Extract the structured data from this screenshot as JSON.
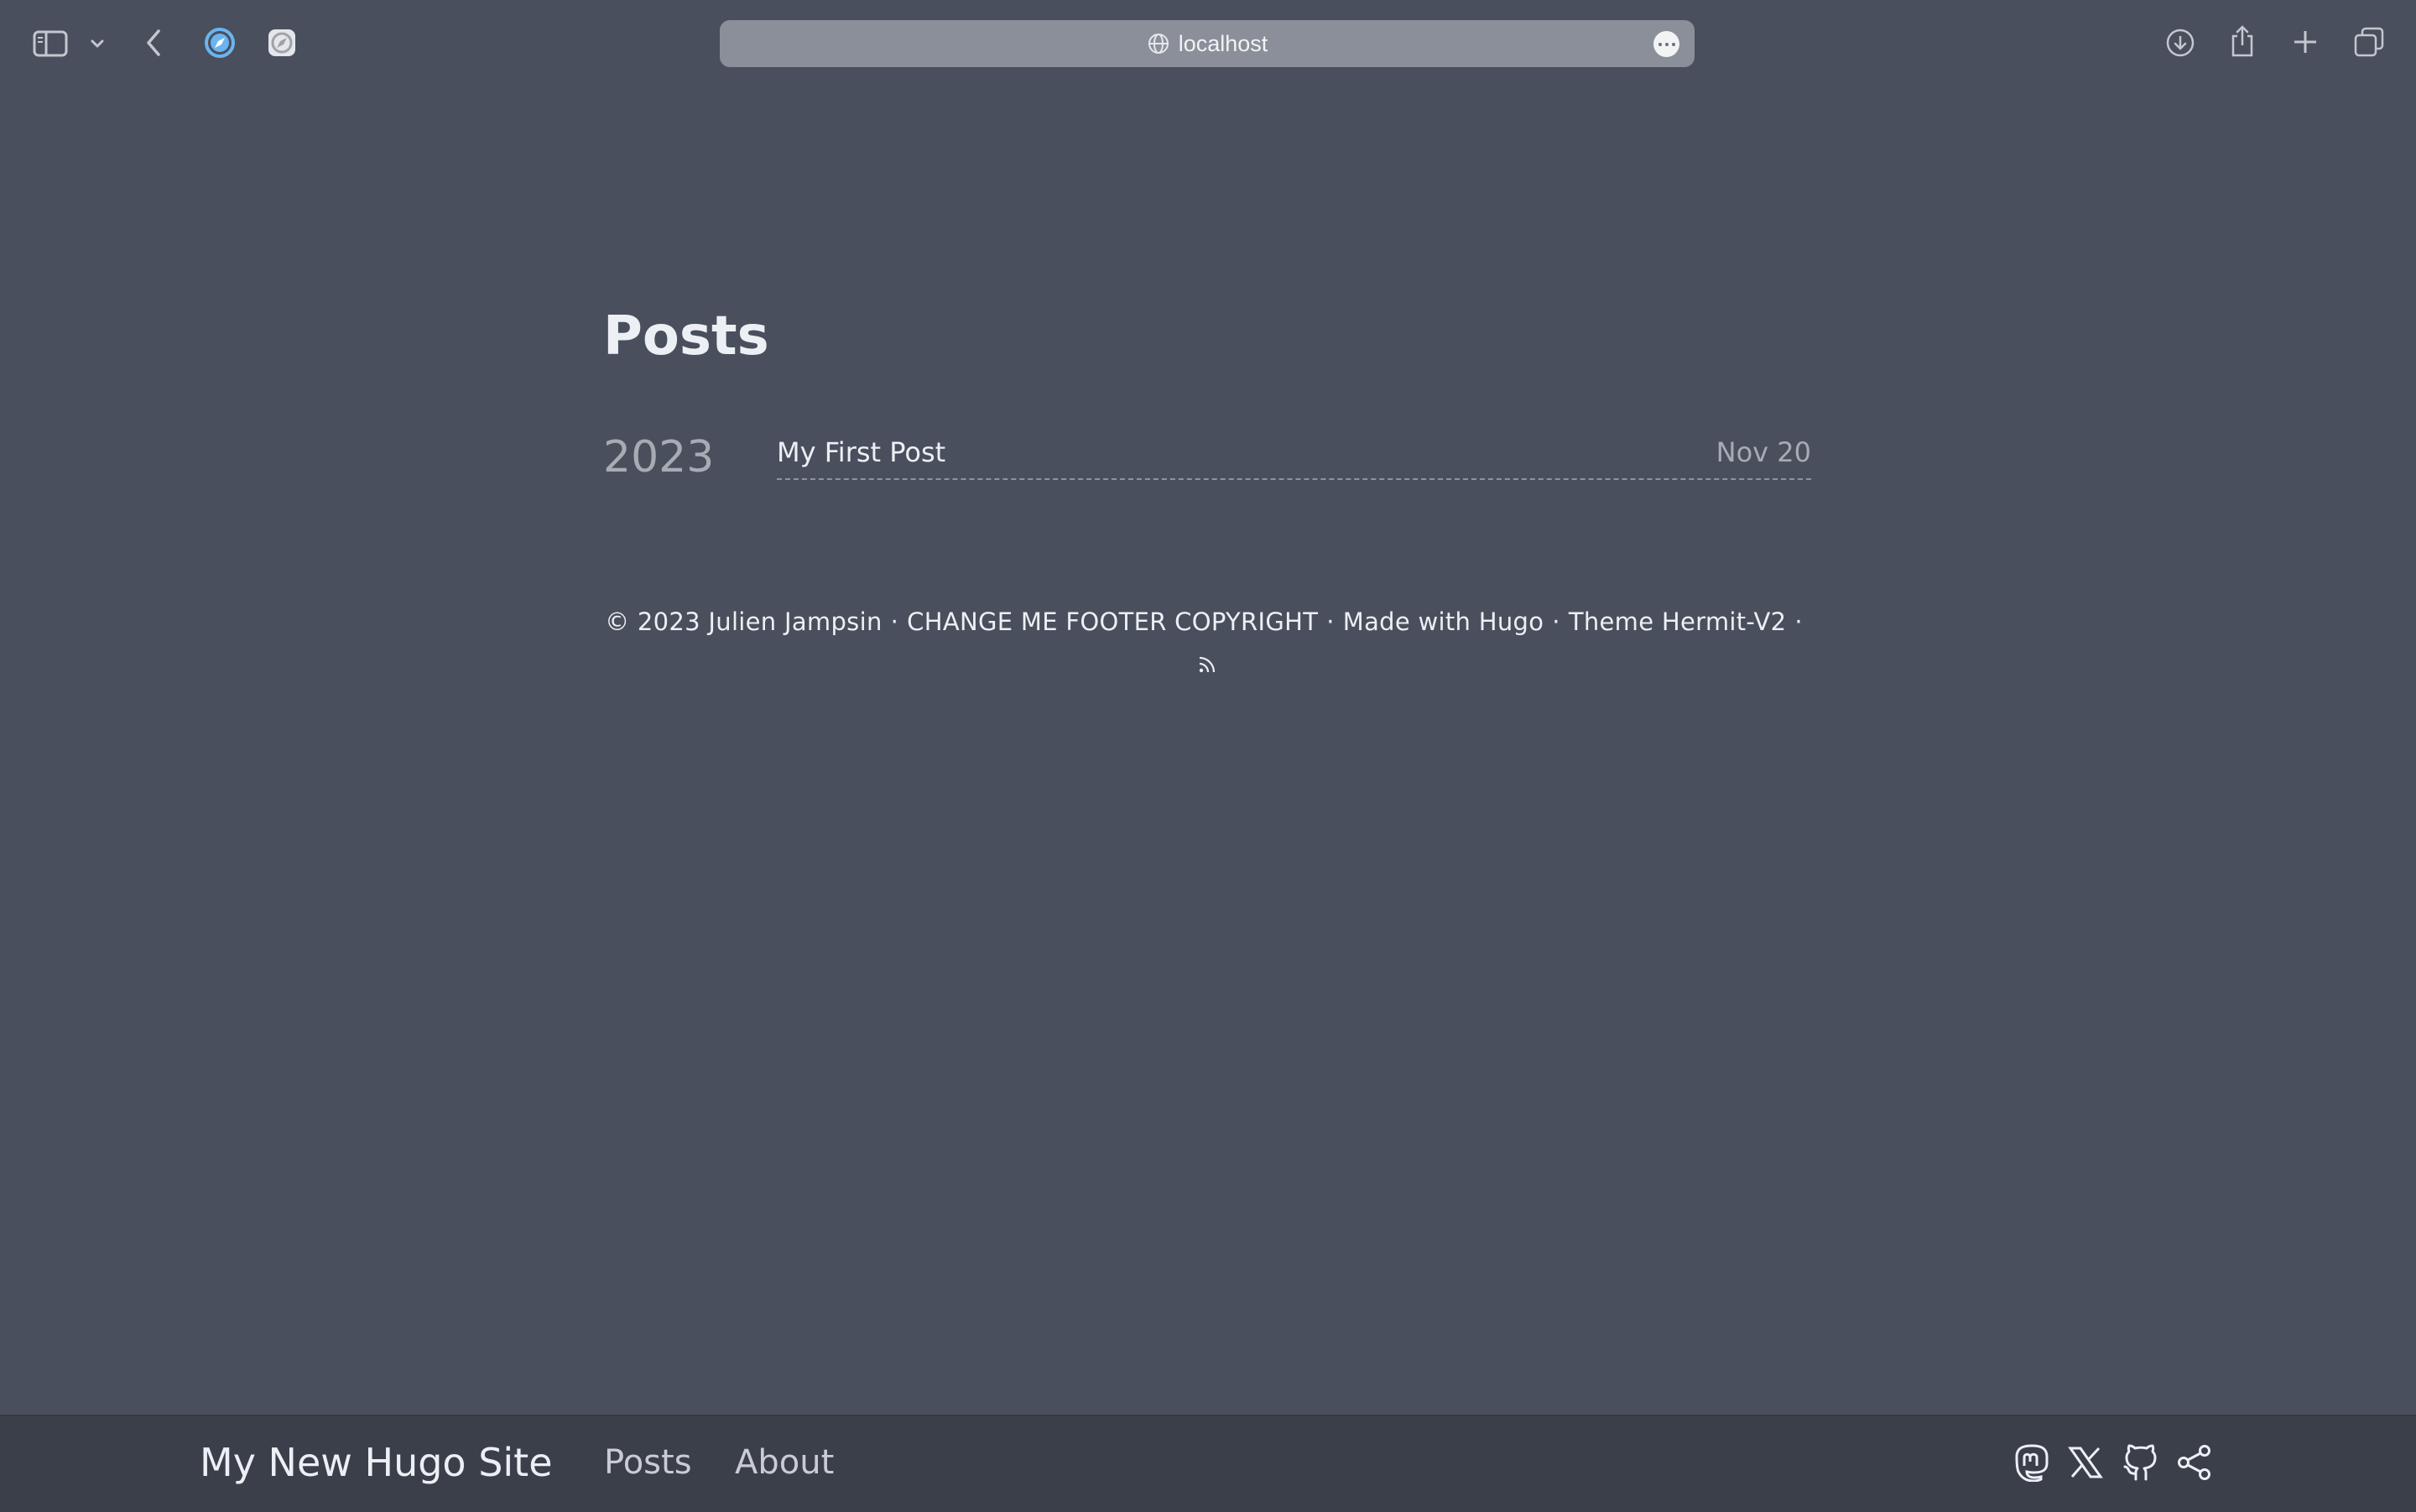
{
  "browser": {
    "url": "localhost",
    "icons": {
      "sidebar": "sidebar-toggle-icon",
      "sidebar_menu": "chevron-down-icon",
      "back": "back-arrow-icon",
      "tab1": "safari-compass-icon",
      "tab2": "compass-gray-icon",
      "more": "ellipsis-icon",
      "download": "download-icon",
      "share": "share-icon",
      "new_tab": "plus-icon",
      "tabs_overview": "tabs-overview-icon"
    }
  },
  "page": {
    "title": "Posts",
    "groups": [
      {
        "year": "2023",
        "posts": [
          {
            "title": "My First Post",
            "date": "Nov 20"
          }
        ]
      }
    ]
  },
  "footer": {
    "copyright": "© 2023 Julien Jampsin",
    "custom": "CHANGE ME FOOTER COPYRIGHT",
    "made_with": "Made with Hugo",
    "theme": "Theme Hermit-V2",
    "separator": "·",
    "rss_icon": "rss-icon"
  },
  "site_nav": {
    "site_name": "My New Hugo Site",
    "links": [
      "Posts",
      "About"
    ],
    "social": [
      "mastodon-icon",
      "x-twitter-icon",
      "github-icon",
      "share-icon"
    ]
  },
  "colors": {
    "background": "#494f5c",
    "nav_background": "#3b3f4a",
    "text": "#eceff4",
    "muted": "#a7abb3",
    "url_bar": "#8a8f99"
  }
}
